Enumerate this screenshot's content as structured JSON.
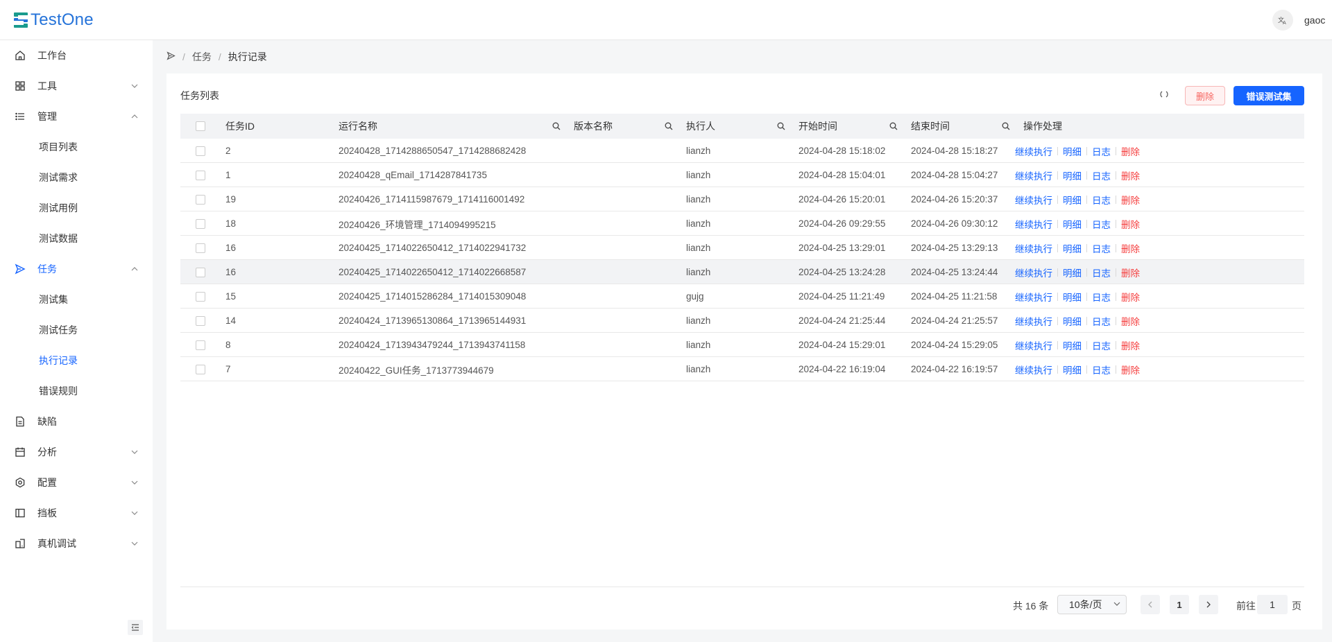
{
  "app": {
    "name": "TestOne"
  },
  "header": {
    "lang_icon": "translate-icon",
    "user": "gaoc"
  },
  "sidebar": {
    "items": [
      {
        "label": "工作台",
        "icon": "home-icon"
      },
      {
        "label": "工具",
        "icon": "grid-icon"
      },
      {
        "label": "管理",
        "icon": "list-icon"
      },
      {
        "label": "任务",
        "icon": "send-icon"
      },
      {
        "label": "缺陷",
        "icon": "file-icon"
      },
      {
        "label": "分析",
        "icon": "calendar-icon"
      },
      {
        "label": "配置",
        "icon": "settings-icon"
      },
      {
        "label": "挡板",
        "icon": "panel-icon"
      },
      {
        "label": "真机调试",
        "icon": "device-icon"
      }
    ],
    "manage_sub": [
      "项目列表",
      "测试需求",
      "测试用例",
      "测试数据"
    ],
    "task_sub": [
      "测试集",
      "测试任务",
      "执行记录",
      "错误规则"
    ]
  },
  "breadcrumb": {
    "items": [
      "任务",
      "执行记录"
    ]
  },
  "card": {
    "title": "任务列表",
    "delete_label": "删除",
    "error_set_label": "错误测试集"
  },
  "table": {
    "columns": [
      "任务ID",
      "运行名称",
      "版本名称",
      "执行人",
      "开始时间",
      "结束时间",
      "操作处理"
    ],
    "actions": [
      "继续执行",
      "明细",
      "日志",
      "删除"
    ],
    "rows": [
      {
        "id": "2",
        "run_name": "20240428_1714288650547_1714288682428",
        "version": "",
        "executor": "lianzh",
        "start": "2024-04-28 15:18:02",
        "end": "2024-04-28 15:18:27"
      },
      {
        "id": "1",
        "run_name": "20240428_qEmail_1714287841735",
        "version": "",
        "executor": "lianzh",
        "start": "2024-04-28 15:04:01",
        "end": "2024-04-28 15:04:27"
      },
      {
        "id": "19",
        "run_name": "20240426_1714115987679_1714116001492",
        "version": "",
        "executor": "lianzh",
        "start": "2024-04-26 15:20:01",
        "end": "2024-04-26 15:20:37"
      },
      {
        "id": "18",
        "run_name": "20240426_环境管理_1714094995215",
        "version": "",
        "executor": "lianzh",
        "start": "2024-04-26 09:29:55",
        "end": "2024-04-26 09:30:12"
      },
      {
        "id": "16",
        "run_name": "20240425_1714022650412_1714022941732",
        "version": "",
        "executor": "lianzh",
        "start": "2024-04-25 13:29:01",
        "end": "2024-04-25 13:29:13"
      },
      {
        "id": "16",
        "run_name": "20240425_1714022650412_1714022668587",
        "version": "",
        "executor": "lianzh",
        "start": "2024-04-25 13:24:28",
        "end": "2024-04-25 13:24:44"
      },
      {
        "id": "15",
        "run_name": "20240425_1714015286284_1714015309048",
        "version": "",
        "executor": "gujg",
        "start": "2024-04-25 11:21:49",
        "end": "2024-04-25 11:21:58"
      },
      {
        "id": "14",
        "run_name": "20240424_1713965130864_1713965144931",
        "version": "",
        "executor": "lianzh",
        "start": "2024-04-24 21:25:44",
        "end": "2024-04-24 21:25:57"
      },
      {
        "id": "8",
        "run_name": "20240424_1713943479244_1713943741158",
        "version": "",
        "executor": "lianzh",
        "start": "2024-04-24 15:29:01",
        "end": "2024-04-24 15:29:05"
      },
      {
        "id": "7",
        "run_name": "20240422_GUI任务_1713773944679",
        "version": "",
        "executor": "lianzh",
        "start": "2024-04-22 16:19:04",
        "end": "2024-04-22 16:19:57"
      }
    ]
  },
  "pagination": {
    "total": "共 16 条",
    "page_size": "10条/页",
    "current": "1",
    "goto_prefix": "前往",
    "goto_value": "1",
    "goto_suffix": "页"
  },
  "colors": {
    "accent": "#1664ff",
    "danger": "#f53f3f"
  }
}
